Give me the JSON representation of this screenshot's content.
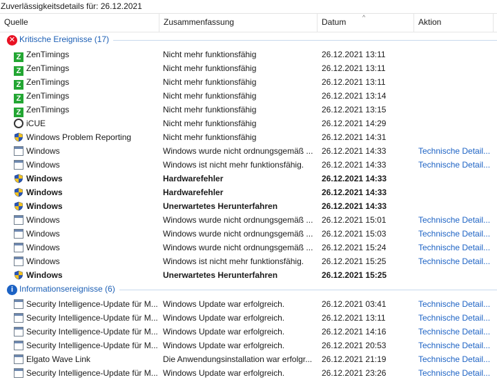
{
  "window": {
    "title": "Zuverlässigkeitsdetails für: 26.12.2021"
  },
  "columns": {
    "source": "Quelle",
    "summary": "Zusammenfassung",
    "date": "Datum",
    "action": "Aktion",
    "sort_indicator": "^"
  },
  "groups": {
    "critical": {
      "label": "Kritische Ereignisse (17)",
      "icon": "error-icon",
      "color": "#e81123",
      "rows": [
        {
          "source": "ZenTimings",
          "icon": "zentimings-icon",
          "summary": "Nicht mehr funktionsfähig",
          "date": "26.12.2021 13:11",
          "action": "",
          "bold": false
        },
        {
          "source": "ZenTimings",
          "icon": "zentimings-icon",
          "summary": "Nicht mehr funktionsfähig",
          "date": "26.12.2021 13:11",
          "action": "",
          "bold": false
        },
        {
          "source": "ZenTimings",
          "icon": "zentimings-icon",
          "summary": "Nicht mehr funktionsfähig",
          "date": "26.12.2021 13:11",
          "action": "",
          "bold": false
        },
        {
          "source": "ZenTimings",
          "icon": "zentimings-icon",
          "summary": "Nicht mehr funktionsfähig",
          "date": "26.12.2021 13:14",
          "action": "",
          "bold": false
        },
        {
          "source": "ZenTimings",
          "icon": "zentimings-icon",
          "summary": "Nicht mehr funktionsfähig",
          "date": "26.12.2021 13:15",
          "action": "",
          "bold": false
        },
        {
          "source": "iCUE",
          "icon": "icue-icon",
          "summary": "Nicht mehr funktionsfähig",
          "date": "26.12.2021 14:29",
          "action": "",
          "bold": false
        },
        {
          "source": "Windows Problem Reporting",
          "icon": "shield-icon",
          "summary": "Nicht mehr funktionsfähig",
          "date": "26.12.2021 14:31",
          "action": "",
          "bold": false
        },
        {
          "source": "Windows",
          "icon": "window-icon",
          "summary": "Windows wurde nicht ordnungsgemäß ...",
          "date": "26.12.2021 14:33",
          "action": "Technische Detail...",
          "bold": false
        },
        {
          "source": "Windows",
          "icon": "window-icon",
          "summary": "Windows ist nicht mehr funktionsfähig.",
          "date": "26.12.2021 14:33",
          "action": "Technische Detail...",
          "bold": false
        },
        {
          "source": "Windows",
          "icon": "shield-icon",
          "summary": "Hardwarefehler",
          "date": "26.12.2021 14:33",
          "action": "",
          "bold": true
        },
        {
          "source": "Windows",
          "icon": "shield-icon",
          "summary": "Hardwarefehler",
          "date": "26.12.2021 14:33",
          "action": "",
          "bold": true
        },
        {
          "source": "Windows",
          "icon": "shield-icon",
          "summary": "Unerwartetes Herunterfahren",
          "date": "26.12.2021 14:33",
          "action": "",
          "bold": true
        },
        {
          "source": "Windows",
          "icon": "window-icon",
          "summary": "Windows wurde nicht ordnungsgemäß ...",
          "date": "26.12.2021 15:01",
          "action": "Technische Detail...",
          "bold": false
        },
        {
          "source": "Windows",
          "icon": "window-icon",
          "summary": "Windows wurde nicht ordnungsgemäß ...",
          "date": "26.12.2021 15:03",
          "action": "Technische Detail...",
          "bold": false
        },
        {
          "source": "Windows",
          "icon": "window-icon",
          "summary": "Windows wurde nicht ordnungsgemäß ...",
          "date": "26.12.2021 15:24",
          "action": "Technische Detail...",
          "bold": false
        },
        {
          "source": "Windows",
          "icon": "window-icon",
          "summary": "Windows ist nicht mehr funktionsfähig.",
          "date": "26.12.2021 15:25",
          "action": "Technische Detail...",
          "bold": false
        },
        {
          "source": "Windows",
          "icon": "shield-icon",
          "summary": "Unerwartetes Herunterfahren",
          "date": "26.12.2021 15:25",
          "action": "",
          "bold": true
        }
      ]
    },
    "info": {
      "label": "Informationsereignisse (6)",
      "icon": "info-icon",
      "color": "#1c62c4",
      "rows": [
        {
          "source": "Security Intelligence-Update für M...",
          "icon": "window-icon",
          "summary": "Windows Update war erfolgreich.",
          "date": "26.12.2021 03:41",
          "action": "Technische Detail...",
          "bold": false
        },
        {
          "source": "Security Intelligence-Update für M...",
          "icon": "window-icon",
          "summary": "Windows Update war erfolgreich.",
          "date": "26.12.2021 13:11",
          "action": "Technische Detail...",
          "bold": false
        },
        {
          "source": "Security Intelligence-Update für M...",
          "icon": "window-icon",
          "summary": "Windows Update war erfolgreich.",
          "date": "26.12.2021 14:16",
          "action": "Technische Detail...",
          "bold": false
        },
        {
          "source": "Security Intelligence-Update für M...",
          "icon": "window-icon",
          "summary": "Windows Update war erfolgreich.",
          "date": "26.12.2021 20:53",
          "action": "Technische Detail...",
          "bold": false
        },
        {
          "source": "Elgato Wave Link",
          "icon": "window-icon",
          "summary": "Die Anwendungsinstallation war erfolgr...",
          "date": "26.12.2021 21:19",
          "action": "Technische Detail...",
          "bold": false
        },
        {
          "source": "Security Intelligence-Update für M...",
          "icon": "window-icon",
          "summary": "Windows Update war erfolgreich.",
          "date": "26.12.2021 23:26",
          "action": "Technische Detail...",
          "bold": false
        }
      ]
    }
  }
}
